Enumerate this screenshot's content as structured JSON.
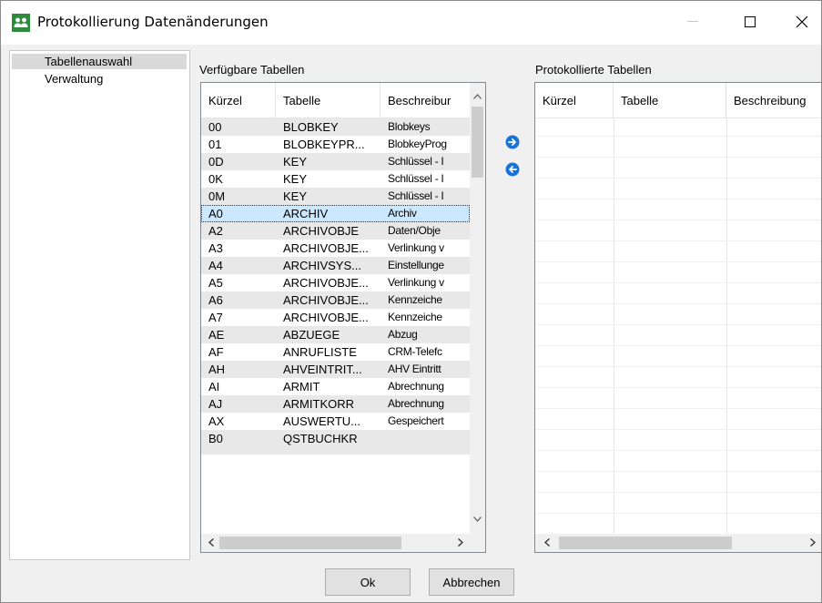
{
  "window": {
    "title": "Protokollierung Datenänderungen"
  },
  "nav": {
    "items": [
      {
        "label": "Tabellenauswahl",
        "selected": true
      },
      {
        "label": "Verwaltung",
        "selected": false
      }
    ]
  },
  "available": {
    "label": "Verfügbare Tabellen",
    "columns": [
      "Kürzel",
      "Tabelle",
      "Beschreibur"
    ],
    "rows": [
      {
        "code": "00",
        "table": "BLOBKEY",
        "desc": "Blobkeys"
      },
      {
        "code": "01",
        "table": "BLOBKEYPR...",
        "desc": "BlobkeyProg"
      },
      {
        "code": "0D",
        "table": "KEY",
        "desc": "Schlüssel - I"
      },
      {
        "code": "0K",
        "table": "KEY",
        "desc": "Schlüssel - I"
      },
      {
        "code": "0M",
        "table": "KEY",
        "desc": "Schlüssel - I"
      },
      {
        "code": "A0",
        "table": "ARCHIV",
        "desc": "Archiv"
      },
      {
        "code": "A2",
        "table": "ARCHIVOBJE",
        "desc": "Daten/Obje"
      },
      {
        "code": "A3",
        "table": "ARCHIVOBJE...",
        "desc": "Verlinkung v"
      },
      {
        "code": "A4",
        "table": "ARCHIVSYS...",
        "desc": "Einstellunge"
      },
      {
        "code": "A5",
        "table": "ARCHIVOBJE...",
        "desc": "Verlinkung v"
      },
      {
        "code": "A6",
        "table": "ARCHIVOBJE...",
        "desc": "Kennzeiche"
      },
      {
        "code": "A7",
        "table": "ARCHIVOBJE...",
        "desc": "Kennzeiche"
      },
      {
        "code": "AE",
        "table": "ABZUEGE",
        "desc": "Abzug"
      },
      {
        "code": "AF",
        "table": "ANRUFLISTE",
        "desc": "CRM-Telefc"
      },
      {
        "code": "AH",
        "table": "AHVEINTRIT...",
        "desc": "AHV Eintritt"
      },
      {
        "code": "AI",
        "table": "ARMIT",
        "desc": "Abrechnung"
      },
      {
        "code": "AJ",
        "table": "ARMITKORR",
        "desc": "Abrechnung"
      },
      {
        "code": "AX",
        "table": "AUSWERTU...",
        "desc": "Gespeichert"
      },
      {
        "code": "B0",
        "table": "QSTBUCHKR",
        "desc": ""
      }
    ],
    "selected_code": "A0"
  },
  "logged": {
    "label": "Protokollierte Tabellen",
    "columns": [
      "Kürzel",
      "Tabelle",
      "Beschreibung"
    ]
  },
  "buttons": {
    "add_icon": "arrow-right-circle-icon",
    "remove_icon": "arrow-left-circle-icon",
    "ok": "Ok",
    "cancel": "Abbrechen"
  },
  "colors": {
    "selection": "#cce8ff",
    "alt_row": "#e8e8e8",
    "arrow_blue": "#1a73d9"
  }
}
